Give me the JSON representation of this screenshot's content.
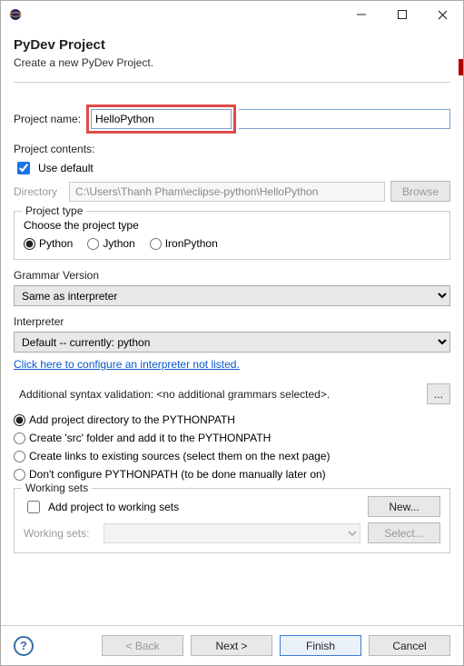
{
  "header": {
    "title": "PyDev Project",
    "subtitle": "Create a new PyDev Project."
  },
  "projectName": {
    "label": "Project name:",
    "value": "HelloPython"
  },
  "contents": {
    "title": "Project contents:",
    "useDefaultLabel": "Use default",
    "directoryLabel": "Directory",
    "directoryValue": "C:\\Users\\Thanh Pham\\eclipse-python\\HelloPython",
    "browseLabel": "Browse"
  },
  "projectType": {
    "title": "Project type",
    "choose": "Choose the project type",
    "options": {
      "python": "Python",
      "jython": "Jython",
      "ironpython": "IronPython"
    }
  },
  "grammar": {
    "title": "Grammar Version",
    "value": "Same as interpreter"
  },
  "interpreter": {
    "title": "Interpreter",
    "value": "Default  --  currently: python",
    "link": "Click here to configure an interpreter not listed."
  },
  "syntax": {
    "label": "Additional syntax validation: <no additional grammars selected>.",
    "button": "..."
  },
  "pythonpath": {
    "opt1": "Add project directory to the PYTHONPATH",
    "opt2": "Create 'src' folder and add it to the PYTHONPATH",
    "opt3": "Create links to existing sources (select them on the next page)",
    "opt4": "Don't configure PYTHONPATH (to be done manually later on)"
  },
  "workingSets": {
    "title": "Working sets",
    "addLabel": "Add project to working sets",
    "newLabel": "New...",
    "wsLabel": "Working sets:",
    "selectLabel": "Select..."
  },
  "footer": {
    "back": "< Back",
    "next": "Next >",
    "finish": "Finish",
    "cancel": "Cancel"
  }
}
